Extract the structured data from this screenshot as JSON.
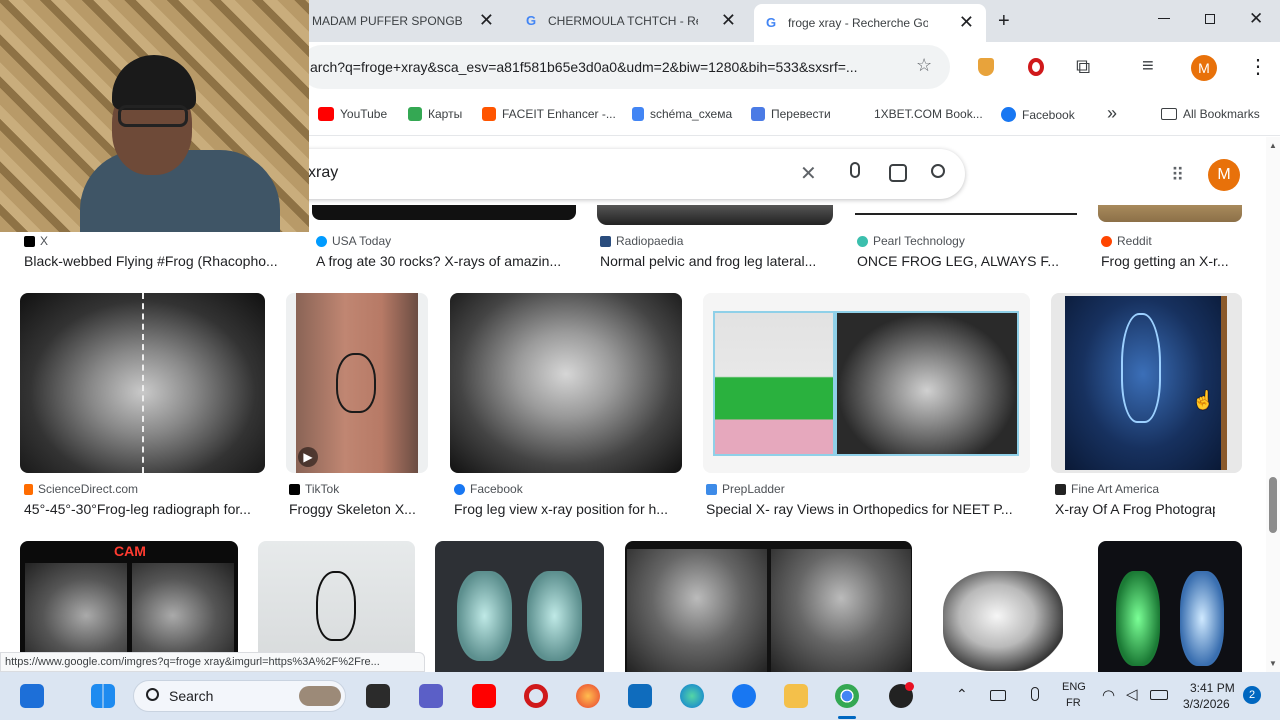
{
  "tabs": [
    {
      "title": "MADAM PUFFER SPONGBOB"
    },
    {
      "title": "CHERMOULA TCHTCH - Rec"
    },
    {
      "title": "froge xray - Recherche Goog"
    }
  ],
  "omnibox": {
    "url": "arch?q=froge+xray&sca_esv=a81f581b65e3d0a0&udm=2&biw=1280&bih=533&sxsrf=..."
  },
  "bookmarks": {
    "items": [
      "YouTube",
      "Карты",
      "FACEIT Enhancer -...",
      "schéma_схема",
      "Перевести",
      "1XBET.COM Book...",
      "Facebook"
    ],
    "more": "»",
    "all": "All Bookmarks"
  },
  "search": {
    "query": "xray",
    "avatar": "M"
  },
  "profile_initial": "M",
  "row0": [
    {
      "source": "X",
      "title": "Black-webbed Flying #Frog (Rhacopho..."
    },
    {
      "source": "USA Today",
      "title": "A frog ate 30 rocks? X-rays of amazin..."
    },
    {
      "source": "Radiopaedia",
      "title": "Normal pelvic and frog leg lateral..."
    },
    {
      "source": "Pearl Technology",
      "title": "ONCE FROG LEG, ALWAYS F..."
    },
    {
      "source": "Reddit",
      "title": "Frog getting an X-r..."
    }
  ],
  "row1": [
    {
      "source": "ScienceDirect.com",
      "title": "45°-45°-30°Frog-leg radiograph for..."
    },
    {
      "source": "TikTok",
      "title": "Froggy Skeleton X..."
    },
    {
      "source": "Facebook",
      "title": "Frog leg view x-ray position for h..."
    },
    {
      "source": "PrepLadder",
      "title": "Special X- ray Views in Orthopedics for NEET P..."
    },
    {
      "source": "Fine Art America",
      "title": "X-ray Of A Frog Photograp..."
    }
  ],
  "row2_label": "CAM",
  "status_url": "https://www.google.com/imgres?q=froge xray&imgurl=https%3A%2F%2Fre...",
  "taskbar": {
    "search_placeholder": "Search",
    "lang1": "ENG",
    "lang2": "FR",
    "time": "3:41 PM",
    "date": "3/3/2026",
    "notif": "2"
  }
}
